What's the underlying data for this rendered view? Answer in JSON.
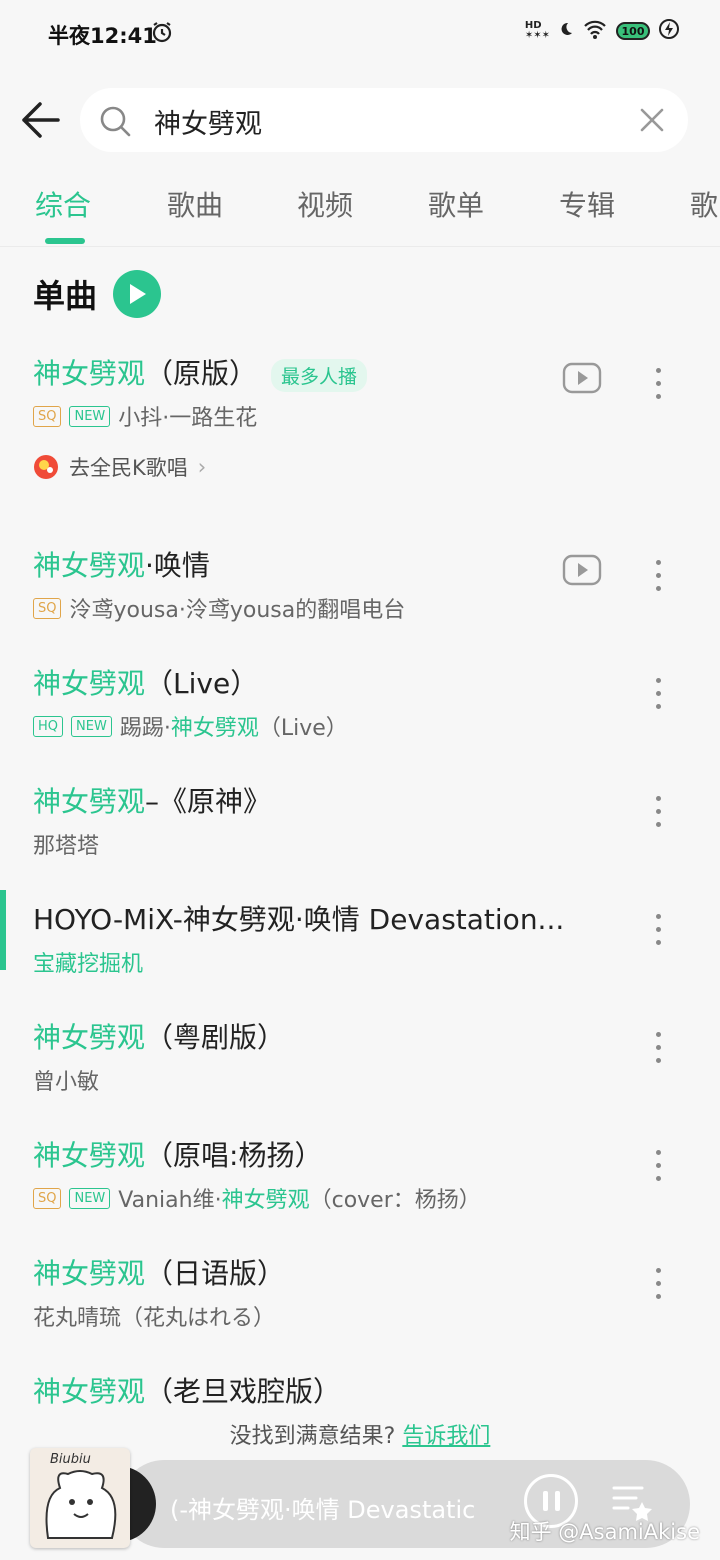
{
  "status": {
    "time": "半夜12:41",
    "hd_label": "HD",
    "battery": "100"
  },
  "search": {
    "query": "神女劈观"
  },
  "tabs": [
    "综合",
    "歌曲",
    "视频",
    "歌单",
    "专辑",
    "歌"
  ],
  "section": {
    "title": "单曲"
  },
  "songs": [
    {
      "title_hl": "神女劈观",
      "title_rest": "（原版）",
      "tag": "最多人播",
      "badges": [
        "SQ",
        "NEW"
      ],
      "artist": "小抖·一路生花"
    },
    {
      "title_hl": "神女劈观",
      "title_rest": "·唤情",
      "badges": [
        "SQ"
      ],
      "artist": "泠鸢yousa·泠鸢yousa的翻唱电台"
    },
    {
      "title_hl": "神女劈观",
      "title_rest": "（Live）",
      "badges": [
        "HQ",
        "NEW"
      ],
      "artist_pre": "踢踢·",
      "artist_hl": "神女劈观",
      "artist_post": "（Live）"
    },
    {
      "title_hl": "神女劈观",
      "title_rest": "–《原神》",
      "artist": "那塔塔"
    },
    {
      "title": "HOYO-MiX-神女劈观·唤情 Devastation...",
      "artist": "宝藏挖掘机"
    },
    {
      "title_hl": "神女劈观",
      "title_rest": "（粤剧版）",
      "artist": "曾小敏"
    },
    {
      "title_hl": "神女劈观",
      "title_rest": "（原唱:杨扬）",
      "badges": [
        "SQ",
        "NEW"
      ],
      "artist_pre": "Vaniah维·",
      "artist_hl": "神女劈观",
      "artist_post": "（cover：杨扬）"
    },
    {
      "title_hl": "神女劈观",
      "title_rest": "（日语版）",
      "artist": "花丸晴琉（花丸はれる）"
    },
    {
      "title_hl": "神女劈观",
      "title_rest": "（老旦戏腔版）"
    }
  ],
  "karaoke": {
    "label": "去全民K歌唱"
  },
  "feedback": {
    "text": "没找到满意结果?",
    "link": "告诉我们"
  },
  "player": {
    "now_playing": "(-神女劈观·唤情 Devastatic",
    "cover_text": "Biubiu"
  },
  "watermark": "知乎 @AsamiAkise",
  "colors": {
    "accent": "#2bc58f",
    "sq_badge": "#e0a54a",
    "background": "#f7f7f7"
  }
}
